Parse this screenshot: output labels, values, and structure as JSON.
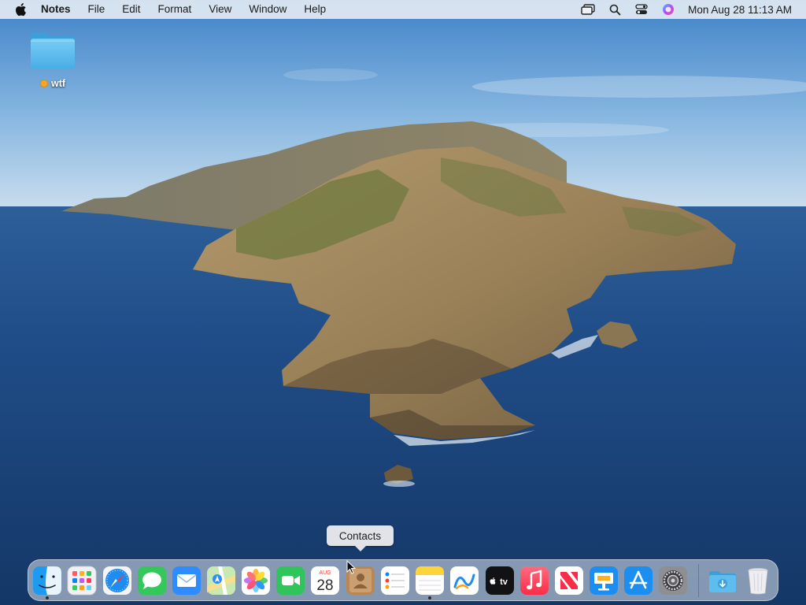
{
  "menubar": {
    "apple_icon": "apple-logo",
    "app_name": "Notes",
    "menus": [
      "File",
      "Edit",
      "Format",
      "View",
      "Window",
      "Help"
    ],
    "status_icons": [
      "screen-mirroring-icon",
      "spotlight-search-icon",
      "control-center-icon",
      "siri-icon"
    ],
    "clock": "Mon Aug 28  11:13 AM"
  },
  "desktop": {
    "folder": {
      "name": "wtf",
      "tag_color": "#f5a623"
    }
  },
  "tooltip": {
    "text": "Contacts"
  },
  "dock": {
    "apps": [
      {
        "name": "Finder",
        "icon": "finder-icon",
        "running": true
      },
      {
        "name": "Launchpad",
        "icon": "launchpad-icon",
        "running": false
      },
      {
        "name": "Safari",
        "icon": "safari-icon",
        "running": false
      },
      {
        "name": "Messages",
        "icon": "messages-icon",
        "running": false
      },
      {
        "name": "Mail",
        "icon": "mail-icon",
        "running": false
      },
      {
        "name": "Maps",
        "icon": "maps-icon",
        "running": false
      },
      {
        "name": "Photos",
        "icon": "photos-icon",
        "running": false
      },
      {
        "name": "FaceTime",
        "icon": "facetime-icon",
        "running": false
      },
      {
        "name": "Calendar",
        "icon": "calendar-icon",
        "running": false,
        "month": "AUG",
        "day": "28"
      },
      {
        "name": "Contacts",
        "icon": "contacts-icon",
        "running": false
      },
      {
        "name": "Reminders",
        "icon": "reminders-icon",
        "running": false
      },
      {
        "name": "Notes",
        "icon": "notes-icon",
        "running": true
      },
      {
        "name": "Freeform",
        "icon": "freeform-icon",
        "running": false
      },
      {
        "name": "TV",
        "icon": "apple-tv-icon",
        "running": false,
        "label": "tv"
      },
      {
        "name": "Music",
        "icon": "music-icon",
        "running": false
      },
      {
        "name": "News",
        "icon": "news-icon",
        "running": false
      },
      {
        "name": "Keynote",
        "icon": "keynote-icon",
        "running": false
      },
      {
        "name": "App Store",
        "icon": "app-store-icon",
        "running": false
      },
      {
        "name": "System Settings",
        "icon": "system-settings-icon",
        "running": false
      },
      {
        "name": "Downloads",
        "icon": "downloads-folder-icon",
        "running": false
      },
      {
        "name": "Trash",
        "icon": "trash-icon",
        "running": false
      }
    ]
  },
  "colors": {
    "menubar_bg": "#eef1f5",
    "sky": "#6fa3d6",
    "ocean": "#1d4a86",
    "island": "#a88a5f",
    "folder": "#5fbcef",
    "tag": "#f5a623"
  }
}
